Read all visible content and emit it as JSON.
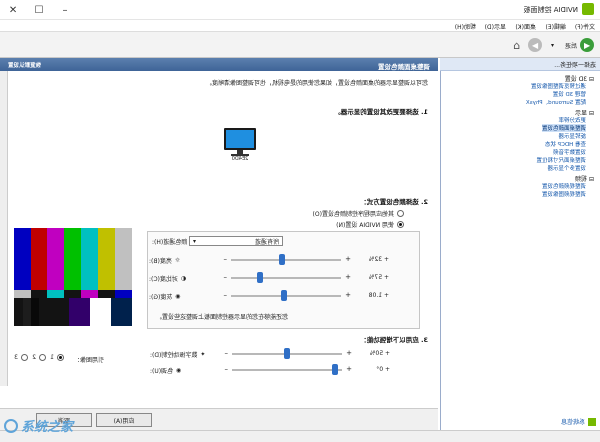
{
  "window": {
    "title": "NVIDIA 控制面板"
  },
  "menu": [
    "文件(F)",
    "编辑(E)",
    "桌面(K)",
    "显示(D)",
    "帮助(H)"
  ],
  "toolbar": {
    "back_label": "后退"
  },
  "taskpane": {
    "title": "选择一项任务...",
    "categories": [
      {
        "label": "3D 设置",
        "items": [
          "通过预览调整图像设置",
          "管理 3D 设置",
          "配置 Surround、PhysX"
        ]
      },
      {
        "label": "显示",
        "items": [
          "更改分辨率",
          "调整桌面颜色设置",
          "旋转显示器",
          "查看 HDCP 状态",
          "设置数字音频",
          "调整桌面尺寸和位置",
          "设置多个显示器"
        ]
      },
      {
        "label": "视频",
        "items": [
          "调整视频颜色设置",
          "调整视频图像设置"
        ]
      }
    ],
    "selected": "调整桌面颜色设置",
    "system_info": "系统信息"
  },
  "main": {
    "header": "调整桌面颜色设置",
    "restore": "恢复默认设置",
    "intro": "您可以调整显示器的桌面颜色设置，如果您使用的是电视机，也可调整图像清晰度。",
    "s1_title": "1. 选择要更改其设置的显示器。",
    "monitor_label": "2E4D0",
    "s2_title": "2. 选择颜色设置方式：",
    "radio_other": "其他应用程序控制颜色设置(O)",
    "radio_nvidia": "使用 NVIDIA 设置(N)",
    "channel_label": "颜色通道(H):",
    "channel_value": "所有通道",
    "brightness_label": "亮度(B):",
    "brightness_value": "+ 32%",
    "contrast_label": "对比度(C):",
    "contrast_value": "+ 57%",
    "gamma_label": "灰度(G):",
    "gamma_value": "+ 1.08",
    "note": "您还能够在您的显示器控制面板上调整这些设置。",
    "s3_title": "3. 应用以下增强功能：",
    "vibrance_label": "数字振动控制(D):",
    "vibrance_value": "+ 50%",
    "hue_label": "色调(U):",
    "hue_value": "+ 0°",
    "ref_label": "引用图像：",
    "ref_options": [
      "1",
      "2",
      "3"
    ],
    "apply_label": "应用(A)",
    "cancel_label": "取消"
  },
  "watermark": "系统之家",
  "colors": {
    "accent": "#2f6fc6",
    "nvidia": "#76b900",
    "header": "#4a6fa3"
  }
}
